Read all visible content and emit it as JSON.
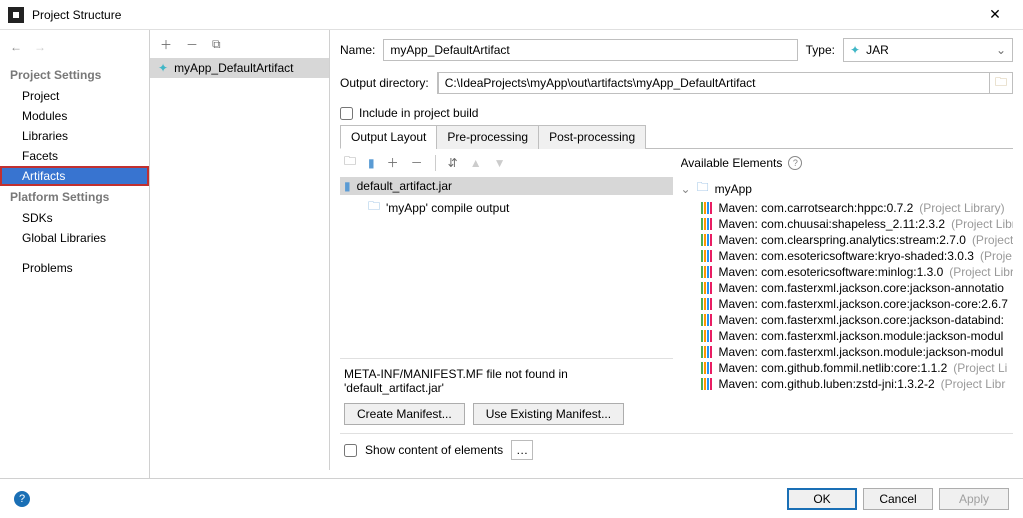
{
  "window": {
    "title": "Project Structure"
  },
  "sidebar": {
    "section1": "Project Settings",
    "items1": [
      "Project",
      "Modules",
      "Libraries",
      "Facets",
      "Artifacts"
    ],
    "section2": "Platform Settings",
    "items2": [
      "SDKs",
      "Global Libraries"
    ],
    "problems": "Problems"
  },
  "artifact_list": {
    "items": [
      {
        "name": "myApp_DefaultArtifact"
      }
    ]
  },
  "detail": {
    "name_label": "Name:",
    "name_value": "myApp_DefaultArtifact",
    "type_label": "Type:",
    "type_value": "JAR",
    "outdir_label": "Output directory:",
    "outdir_value": "C:\\IdeaProjects\\myApp\\out\\artifacts\\myApp_DefaultArtifact",
    "include_label": "Include in project build",
    "tabs": [
      "Output Layout",
      "Pre-processing",
      "Post-processing"
    ],
    "tree": {
      "root": "default_artifact.jar",
      "child": "'myApp' compile output"
    },
    "manifest_msg": "META-INF/MANIFEST.MF file not found in 'default_artifact.jar'",
    "create_btn": "Create Manifest...",
    "use_btn": "Use Existing Manifest...",
    "show_content": "Show content of elements"
  },
  "available": {
    "header": "Available Elements",
    "root": "myApp",
    "libs": [
      {
        "name": "Maven: com.carrotsearch:hppc:0.7.2",
        "suffix": " (Project Library)"
      },
      {
        "name": "Maven: com.chuusai:shapeless_2.11:2.3.2",
        "suffix": " (Project Libr"
      },
      {
        "name": "Maven: com.clearspring.analytics:stream:2.7.0",
        "suffix": " (Project"
      },
      {
        "name": "Maven: com.esotericsoftware:kryo-shaded:3.0.3",
        "suffix": " (Proje"
      },
      {
        "name": "Maven: com.esotericsoftware:minlog:1.3.0",
        "suffix": " (Project Libr"
      },
      {
        "name": "Maven: com.fasterxml.jackson.core:jackson-annotatio",
        "suffix": ""
      },
      {
        "name": "Maven: com.fasterxml.jackson.core:jackson-core:2.6.7",
        "suffix": ""
      },
      {
        "name": "Maven: com.fasterxml.jackson.core:jackson-databind:",
        "suffix": ""
      },
      {
        "name": "Maven: com.fasterxml.jackson.module:jackson-modul",
        "suffix": ""
      },
      {
        "name": "Maven: com.fasterxml.jackson.module:jackson-modul",
        "suffix": ""
      },
      {
        "name": "Maven: com.github.fommil.netlib:core:1.1.2",
        "suffix": " (Project Li"
      },
      {
        "name": "Maven: com.github.luben:zstd-jni:1.3.2-2",
        "suffix": " (Project Libr"
      }
    ]
  },
  "footer": {
    "ok": "OK",
    "cancel": "Cancel",
    "apply": "Apply"
  }
}
